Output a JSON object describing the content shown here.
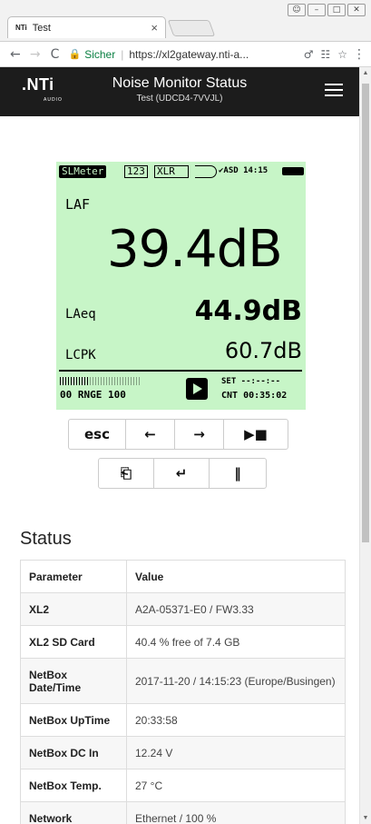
{
  "browser": {
    "tab_favicon": "NTi",
    "tab_title": "Test",
    "tab_close": "×",
    "back": "←",
    "forward": "→",
    "reload": "C",
    "secure_label": "Sicher",
    "url": "https://xl2gateway.nti-a...",
    "window_controls": [
      "☺",
      "–",
      "□",
      "✕"
    ],
    "menu": "⋮"
  },
  "header": {
    "logo": ".NTi",
    "logo_sub": "AUDIO",
    "title": "Noise Monitor Status",
    "subtitle": "Test (UDCD4-7VVJL)"
  },
  "display": {
    "mode": "SLMeter",
    "tag_123": "123",
    "tag_xlr": "XLR",
    "asd_time": "✔ASD 14:15",
    "laf_label": "LAF",
    "laf_value": "39.4dB",
    "laeq_label": "LAeq",
    "laeq_value": "44.9dB",
    "lcpk_label": "LCPK",
    "lcpk_value": "60.7dB",
    "range": "00 RNGE 100",
    "set": "SET --:--:--",
    "cnt": "CNT 00:35:02"
  },
  "keys_row1": [
    {
      "name": "esc-key",
      "label": "esc"
    },
    {
      "name": "left-arrow-key",
      "label": "←"
    },
    {
      "name": "right-arrow-key",
      "label": "→"
    },
    {
      "name": "start-stop-key",
      "label": "▶■"
    }
  ],
  "keys_row2": [
    {
      "name": "page-key",
      "label": "⎗"
    },
    {
      "name": "enter-key",
      "label": "↵"
    },
    {
      "name": "pause-key",
      "label": "‖"
    }
  ],
  "status": {
    "title": "Status",
    "headers": [
      "Parameter",
      "Value"
    ],
    "rows": [
      {
        "param": "XL2",
        "value": "A2A-05371-E0 / FW3.33"
      },
      {
        "param": "XL2 SD Card",
        "value": "40.4 % free of 7.4 GB"
      },
      {
        "param": "NetBox Date/Time",
        "value": "2017-11-20 / 14:15:23 (Europe/Busingen)"
      },
      {
        "param": "NetBox UpTime",
        "value": "20:33:58"
      },
      {
        "param": "NetBox DC In",
        "value": "12.24 V"
      },
      {
        "param": "NetBox Temp.",
        "value": "27 °C"
      },
      {
        "param": "Network",
        "value": "Ethernet / 100 %"
      }
    ]
  }
}
